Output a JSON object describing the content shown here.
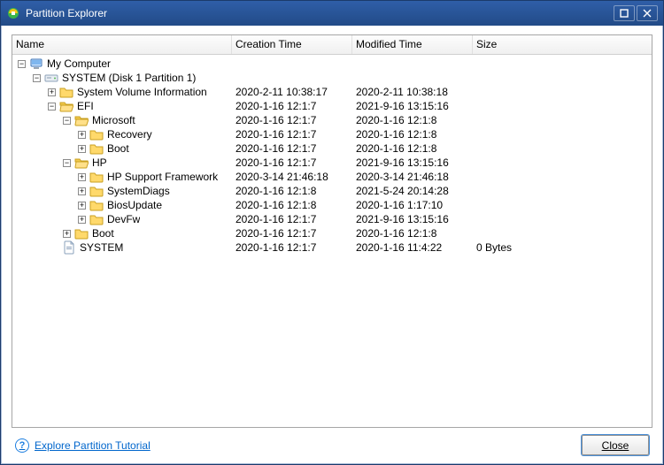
{
  "window": {
    "title": "Partition Explorer"
  },
  "columns": {
    "name": "Name",
    "creation": "Creation Time",
    "modified": "Modified Time",
    "size": "Size"
  },
  "footer": {
    "help_link": "Explore Partition Tutorial",
    "close_label": "Close"
  },
  "tree": [
    {
      "depth": 0,
      "exp": "minus",
      "icon": "computer",
      "name": "My Computer",
      "ct": "",
      "mt": "",
      "size": ""
    },
    {
      "depth": 1,
      "exp": "minus",
      "icon": "drive",
      "name": "SYSTEM (Disk 1 Partition 1)",
      "ct": "",
      "mt": "",
      "size": ""
    },
    {
      "depth": 2,
      "exp": "plus",
      "icon": "folder",
      "name": "System Volume Information",
      "ct": "2020-2-11 10:38:17",
      "mt": "2020-2-11 10:38:18",
      "size": ""
    },
    {
      "depth": 2,
      "exp": "minus",
      "icon": "folder-open",
      "name": "EFI",
      "ct": "2020-1-16 12:1:7",
      "mt": "2021-9-16 13:15:16",
      "size": ""
    },
    {
      "depth": 3,
      "exp": "minus",
      "icon": "folder-open",
      "name": "Microsoft",
      "ct": "2020-1-16 12:1:7",
      "mt": "2020-1-16 12:1:8",
      "size": ""
    },
    {
      "depth": 4,
      "exp": "plus",
      "icon": "folder",
      "name": "Recovery",
      "ct": "2020-1-16 12:1:7",
      "mt": "2020-1-16 12:1:8",
      "size": ""
    },
    {
      "depth": 4,
      "exp": "plus",
      "icon": "folder",
      "name": "Boot",
      "ct": "2020-1-16 12:1:7",
      "mt": "2020-1-16 12:1:8",
      "size": ""
    },
    {
      "depth": 3,
      "exp": "minus",
      "icon": "folder-open",
      "name": "HP",
      "ct": "2020-1-16 12:1:7",
      "mt": "2021-9-16 13:15:16",
      "size": ""
    },
    {
      "depth": 4,
      "exp": "plus",
      "icon": "folder",
      "name": "HP Support Framework",
      "ct": "2020-3-14 21:46:18",
      "mt": "2020-3-14 21:46:18",
      "size": ""
    },
    {
      "depth": 4,
      "exp": "plus",
      "icon": "folder",
      "name": "SystemDiags",
      "ct": "2020-1-16 12:1:8",
      "mt": "2021-5-24 20:14:28",
      "size": ""
    },
    {
      "depth": 4,
      "exp": "plus",
      "icon": "folder",
      "name": "BiosUpdate",
      "ct": "2020-1-16 12:1:8",
      "mt": "2020-1-16 1:17:10",
      "size": ""
    },
    {
      "depth": 4,
      "exp": "plus",
      "icon": "folder",
      "name": "DevFw",
      "ct": "2020-1-16 12:1:7",
      "mt": "2021-9-16 13:15:16",
      "size": ""
    },
    {
      "depth": 3,
      "exp": "plus",
      "icon": "folder",
      "name": "Boot",
      "ct": "2020-1-16 12:1:7",
      "mt": "2020-1-16 12:1:8",
      "size": ""
    },
    {
      "depth": 2,
      "exp": "none",
      "icon": "file",
      "name": "SYSTEM",
      "ct": "2020-1-16 12:1:7",
      "mt": "2020-1-16 11:4:22",
      "size": "0 Bytes"
    }
  ]
}
